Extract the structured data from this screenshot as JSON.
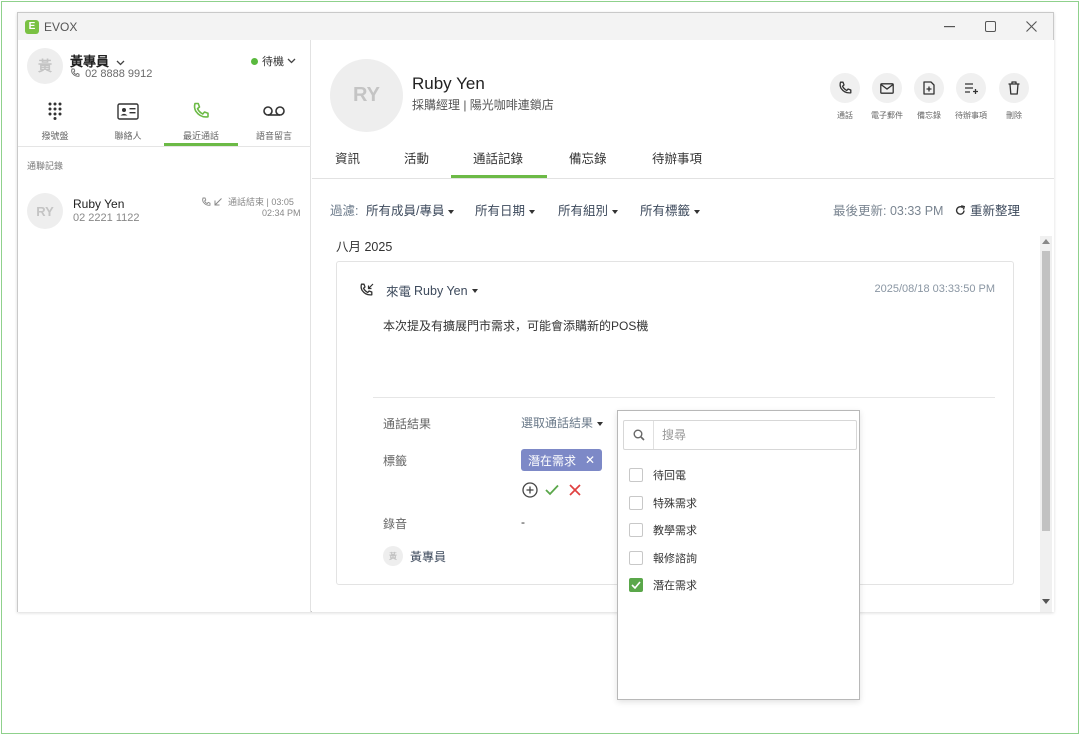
{
  "window": {
    "app_title": "EVOX",
    "logo_letter": "E"
  },
  "agent": {
    "avatar_text": "黃",
    "name": "黃專員",
    "phone": "02 8888 9912",
    "status": "待機"
  },
  "nav": [
    {
      "label": "撥號盤"
    },
    {
      "label": "聯絡人"
    },
    {
      "label": "最近通話"
    },
    {
      "label": "語音留言"
    }
  ],
  "recent": {
    "section_title": "通聯記錄",
    "items": [
      {
        "avatar_text": "RY",
        "name": "Ruby Yen",
        "phone": "02 2221 1122",
        "meta": "通話結束 | 03:05",
        "time": "02:34 PM"
      }
    ]
  },
  "contact": {
    "avatar_text": "RY",
    "name": "Ruby Yen",
    "title": "採購經理 | 陽光咖啡連鎖店",
    "actions": [
      {
        "label": "通話"
      },
      {
        "label": "電子郵件"
      },
      {
        "label": "備忘錄"
      },
      {
        "label": "待辦事項"
      },
      {
        "label": "刪除"
      }
    ]
  },
  "tabs": [
    {
      "label": "資訊"
    },
    {
      "label": "活動"
    },
    {
      "label": "通話記錄"
    },
    {
      "label": "備忘錄"
    },
    {
      "label": "待辦事項"
    }
  ],
  "filters": {
    "label": "過濾:",
    "members": "所有成員/專員",
    "dates": "所有日期",
    "groups": "所有組別",
    "tags": "所有標籤",
    "last_update": "最後更新: 03:33 PM",
    "refresh": "重新整理"
  },
  "month": "八月 2025",
  "call_card": {
    "direction": "來電",
    "name": "Ruby Yen",
    "date": "2025/08/18 03:33:50 PM",
    "note": "本次提及有擴展門市需求，可能會添購新的POS機",
    "result_label": "通話結果",
    "result_placeholder": "選取通話結果",
    "tags_label": "標籤",
    "tag": "潛在需求",
    "recording_label": "錄音",
    "recording_value": "-",
    "agent_avatar": "黃",
    "agent_name": "黃專員"
  },
  "tag_dropdown": {
    "search_placeholder": "搜尋",
    "options": [
      {
        "label": "待回電",
        "checked": false
      },
      {
        "label": "特殊需求",
        "checked": false
      },
      {
        "label": "教學需求",
        "checked": false
      },
      {
        "label": "報修諮詢",
        "checked": false
      },
      {
        "label": "潛在需求",
        "checked": true
      }
    ]
  },
  "colors": {
    "accent": "#6cba46",
    "tag": "#7d89c7",
    "checked": "#5aa74a"
  }
}
